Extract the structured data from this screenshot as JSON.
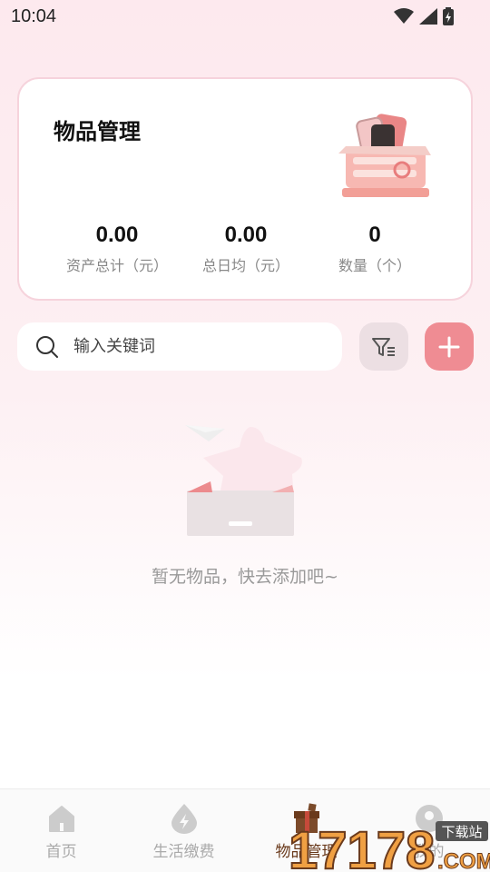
{
  "status_bar": {
    "time": "10:04"
  },
  "summary_card": {
    "title": "物品管理",
    "stats": [
      {
        "value": "0.00",
        "label": "资产总计（元）"
      },
      {
        "value": "0.00",
        "label": "总日均（元）"
      },
      {
        "value": "0",
        "label": "数量（个）"
      }
    ]
  },
  "search": {
    "placeholder": "输入关键词"
  },
  "empty_state": {
    "message": "暂无物品，快去添加吧~"
  },
  "tab_bar": {
    "items": [
      {
        "label": "首页",
        "icon": "home-icon"
      },
      {
        "label": "生活缴费",
        "icon": "lightning-drop-icon"
      },
      {
        "label": "物品管理",
        "icon": "gift-box-icon",
        "active": true
      },
      {
        "label": "我的",
        "icon": "profile-icon"
      }
    ]
  },
  "watermark": {
    "text": "17178.COM",
    "badge": "下载站"
  },
  "colors": {
    "accent": "#ef8c93",
    "card_border": "#f6d3dc",
    "active_tab": "#6a3a1c"
  }
}
